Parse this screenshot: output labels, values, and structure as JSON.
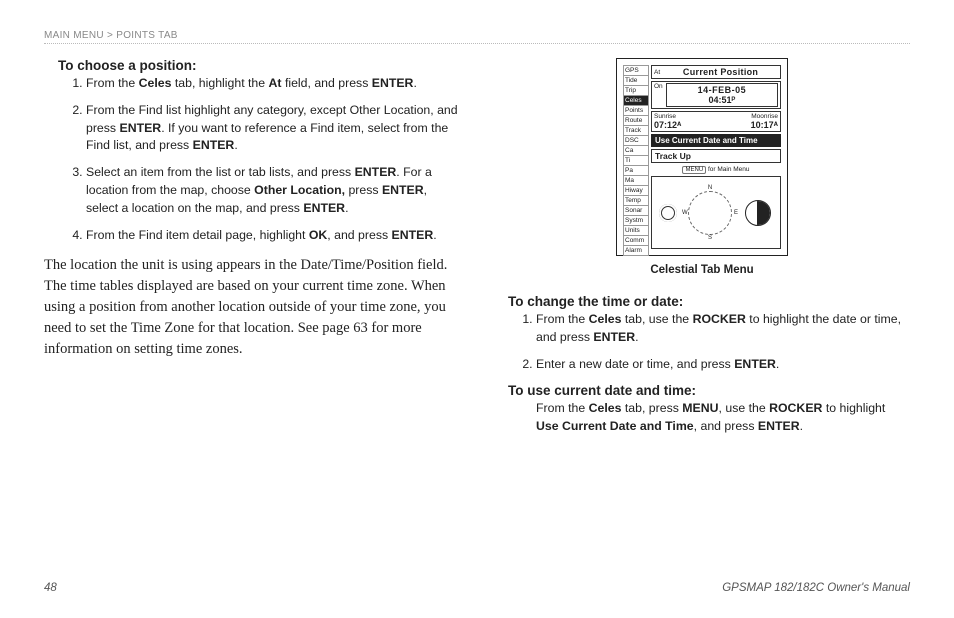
{
  "breadcrumb": {
    "a": "Main Menu",
    "sep": ">",
    "b": "Points Tab"
  },
  "left": {
    "heading": "To choose a position:",
    "steps": {
      "s1a": "From the ",
      "s1b": "Celes",
      "s1c": " tab, highlight the ",
      "s1d": "At",
      "s1e": " field, and press ",
      "s1f": "ENTER",
      "s1g": ".",
      "s2a": "From the Find list highlight any category, except Other Location, and press ",
      "s2b": "ENTER",
      "s2c": ". If you want to reference a Find item, select from the Find list, and press ",
      "s2d": "ENTER",
      "s2e": ".",
      "s3a": "Select an item from the list or tab lists, and press ",
      "s3b": "ENTER",
      "s3c": ". For a location from the map, choose ",
      "s3d": "Other Location,",
      "s3e": " press ",
      "s3f": "ENTER",
      "s3g": ", select a location on the map, and press ",
      "s3h": "ENTER",
      "s3i": ".",
      "s4a": "From the Find item detail page, highlight ",
      "s4b": "OK",
      "s4c": ", and press ",
      "s4d": "ENTER",
      "s4e": "."
    },
    "para": "The location the unit is using appears in the Date/Time/Position field. The time tables displayed are based on your current time zone. When using a position from another location outside of your time zone, you need to set the Time Zone for that location. See page 63 for more information on setting time zones."
  },
  "right": {
    "caption": "Celestial Tab Menu",
    "h2": "To change the time or date:",
    "steps2": {
      "s1a": "From the ",
      "s1b": "Celes",
      "s1c": " tab, use the ",
      "s1d": "ROCKER",
      "s1e": " to highlight the date or time, and press ",
      "s1f": "ENTER",
      "s1g": ".",
      "s2a": "Enter a new date or time, and press ",
      "s2b": "ENTER",
      "s2c": "."
    },
    "h3": "To use current date and time:",
    "p3a": "From the ",
    "p3b": "Celes",
    "p3c": " tab, press ",
    "p3d": "MENU",
    "p3e": ", use the ",
    "p3f": "ROCKER",
    "p3g": " to highlight ",
    "p3h": "Use Current Date and Time",
    "p3i": ", and press ",
    "p3j": "ENTER",
    "p3k": "."
  },
  "device": {
    "tabs": [
      "GPS",
      "Tide",
      "Trip",
      "Celes",
      "Points",
      "Route",
      "Track",
      "DSC",
      "Ca",
      "Ti",
      "Pa",
      "Ma",
      "Hiway",
      "Temp",
      "Sonar",
      "Systm",
      "Units",
      "Comm",
      "Alarm"
    ],
    "activeTab": "Celes",
    "at_lbl": "At",
    "at_val": "Current Position",
    "on_lbl": "On",
    "date": "14-FEB-05",
    "time": "04:51ᴾ",
    "sunrise_lbl": "Sunrise",
    "moonrise_lbl": "Moonrise",
    "sunrise": "07:12ᴬ",
    "moonrise": "10:17ᴬ",
    "menu1": "Use Current Date and Time",
    "menu2": "Track Up",
    "hint_btn": "MENU",
    "hint_txt": " for Main Menu",
    "compass": {
      "n": "N",
      "s": "S",
      "e": "E",
      "w": "W"
    }
  },
  "footer": {
    "page": "48",
    "title": "GPSMAP 182/182C Owner's Manual"
  }
}
